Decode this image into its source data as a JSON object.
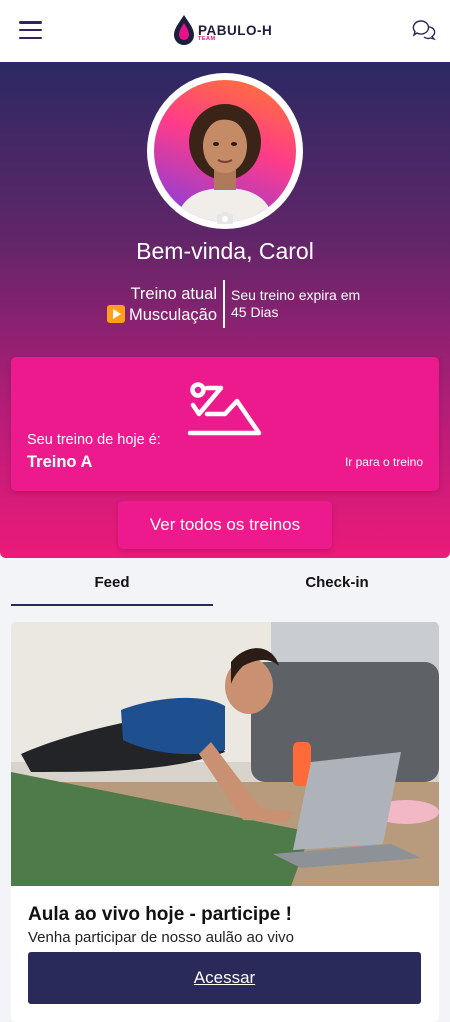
{
  "header": {
    "brand": "PABULO-H",
    "brand_sub": "TEAM",
    "icons": {
      "menu": "hamburger-menu-icon",
      "chat": "chat-bubbles-icon"
    }
  },
  "profile": {
    "welcome": "Bem-vinda, Carol",
    "current_label": "Treino atual",
    "current_value": "Musculação",
    "expires_label": "Seu treino expira em",
    "expires_value": "45 Dias"
  },
  "today": {
    "label": "Seu treino de hoje é:",
    "name": "Treino A",
    "link": "Ir para o treino"
  },
  "all_workouts_button": "Ver todos os treinos",
  "tabs": [
    {
      "label": "Feed",
      "active": true
    },
    {
      "label": "Check-in",
      "active": false
    }
  ],
  "feed": {
    "title": "Aula ao vivo hoje - participe !",
    "subtitle": "Venha participar de nosso aulão ao vivo",
    "button": "Acessar"
  },
  "colors": {
    "brand_dark": "#2a2a5a",
    "brand_pink": "#ec1a8c"
  }
}
